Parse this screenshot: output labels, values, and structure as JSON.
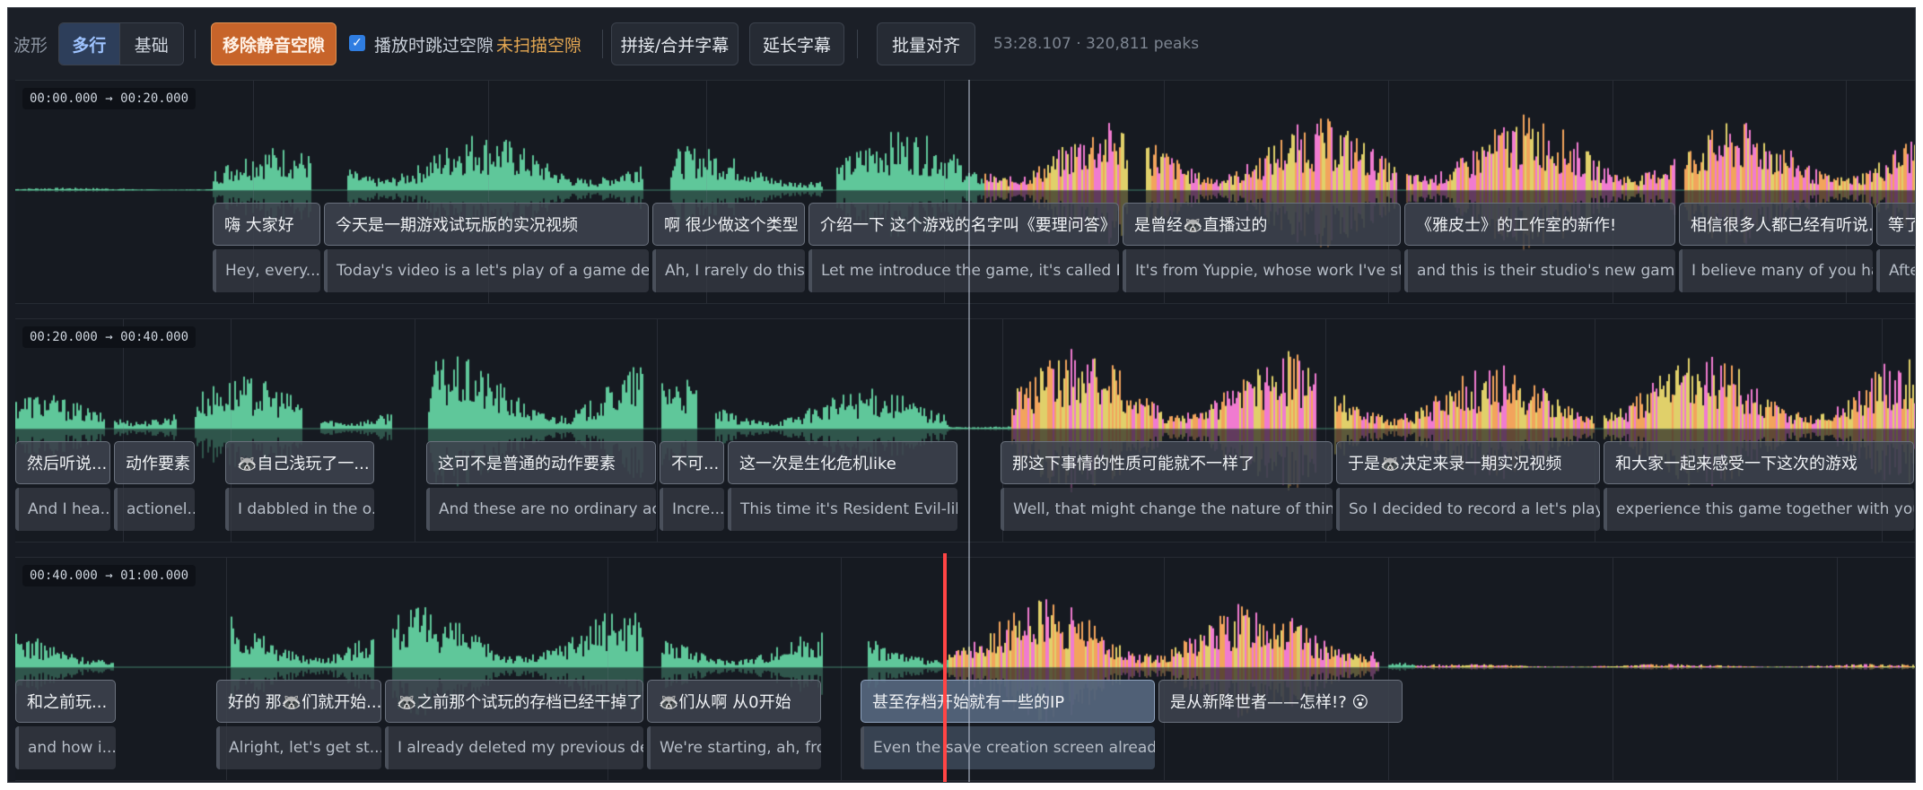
{
  "toolbar": {
    "waveform_label": "波形",
    "mode_multi": "多行",
    "mode_basic": "基础",
    "remove_silence": "移除静音空隙",
    "skip_gaps_label": "播放时跳过空隙",
    "skip_gaps_checked": true,
    "not_scanned": "未扫描空隙",
    "concat_merge": "拼接/合并字幕",
    "extend_subs": "延长字幕",
    "batch_align": "批量对齐",
    "info": "53:28.107 · 320,811 peaks"
  },
  "colors": {
    "wave_idle": "#5fc79a",
    "wave_active_a": "#f07bd0",
    "wave_active_b": "#f2a45c",
    "wave_active_c": "#e0d06a",
    "playhead": "#b4becd",
    "cursor": "#ff4545",
    "accent": "#c7642a"
  },
  "rows": [
    {
      "time_range": "00:00.000 → 00:20.000",
      "cues": [
        {
          "zh": "嗨 大家好",
          "en": "Hey, every..."
        },
        {
          "zh": "今天是一期游戏试玩版的实况视频",
          "en": "Today's video is a let's play of a game demo"
        },
        {
          "zh": "啊 很少做这个类型",
          "en": "Ah, I rarely do this..."
        },
        {
          "zh": "介绍一下 这个游戏的名字叫《要理问答》",
          "en": "Let me introduce the game, it's called Phar..."
        },
        {
          "zh": "是曾经🦝直播过的",
          "en": "It's from Yuppie, whose work I've stre..."
        },
        {
          "zh": "《雅皮士》的工作室的新作!",
          "en": "and this is their studio's new game"
        },
        {
          "zh": "相信很多人都已经有听说...",
          "en": "I believe many of you ha..."
        },
        {
          "zh": "等了这",
          "en": "After"
        }
      ]
    },
    {
      "time_range": "00:20.000 → 00:40.000",
      "cues": [
        {
          "zh": "然后听说...",
          "en": "And I hea..."
        },
        {
          "zh": "动作要素",
          "en": "actionel..."
        },
        {
          "zh": "🦝自己浅玩了一...",
          "en": "I dabbled in the o..."
        },
        {
          "zh": "这可不是普通的动作要素",
          "en": "And these are no ordinary acti..."
        },
        {
          "zh": "不可...",
          "en": "Incre..."
        },
        {
          "zh": "这一次是生化危机like",
          "en": "This time it's Resident Evil-like"
        },
        {
          "zh": "那这下事情的性质可能就不一样了",
          "en": "Well, that might change the nature of things ..."
        },
        {
          "zh": "于是🦝决定来录一期实况视频",
          "en": "So I decided to record a let's play v..."
        },
        {
          "zh": "和大家一起来感受一下这次的游戏",
          "en": "experience this game together with you all"
        }
      ]
    },
    {
      "time_range": "00:40.000 → 01:00.000",
      "cues": [
        {
          "zh": "和之前玩...",
          "en": "and how i..."
        },
        {
          "zh": "好的 那🦝们就开始...",
          "en": "Alright, let's get st..."
        },
        {
          "zh": "🦝之前那个试玩的存档已经干掉了~",
          "en": "I already deleted my previous dem..."
        },
        {
          "zh": "🦝们从啊 从0开始",
          "en": "We're starting, ah, fro..."
        },
        {
          "zh": "甚至存档开始就有一些的IP",
          "en": "Even the save creation screen already h..."
        },
        {
          "zh": "是从新降世者——怎样!? 😮",
          "en": ""
        }
      ]
    }
  ]
}
